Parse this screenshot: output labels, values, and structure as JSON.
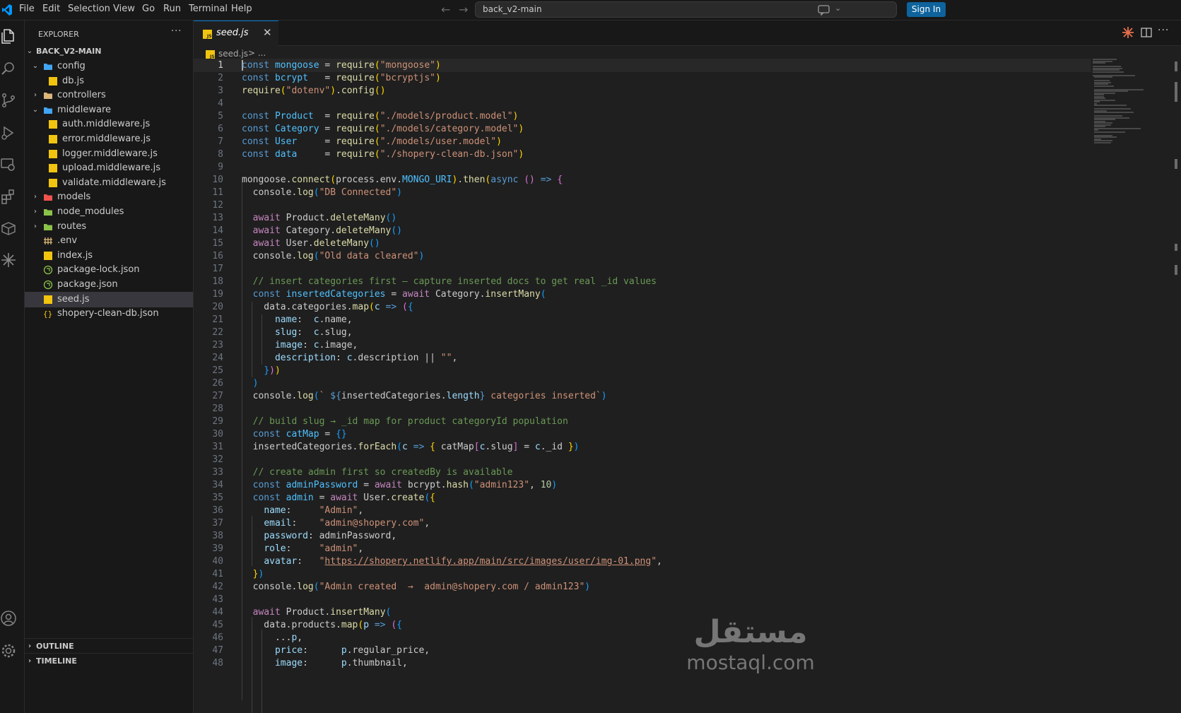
{
  "menu": [
    "File",
    "Edit",
    "Selection",
    "View",
    "Go",
    "Run",
    "Terminal",
    "Help"
  ],
  "command_center": {
    "text": "back_v2-main"
  },
  "sign_in_label": "Sign In",
  "colors": {
    "accent": "#0078d4",
    "sign_in_bg": "#0e639c",
    "js_icon": "#f1c40f",
    "folder": "#dcb67a"
  },
  "activity": [
    "explorer-icon",
    "search-icon",
    "source-control-icon",
    "run-debug-icon",
    "remote-explorer-icon",
    "extensions-icon",
    "containers-icon",
    "sparkle-icon",
    "account-icon",
    "settings-gear-icon"
  ],
  "sidebar": {
    "title": "EXPLORER",
    "more": "···",
    "root": "BACK_V2-MAIN",
    "items": [
      {
        "label": "config",
        "kind": "folder-open",
        "icon": "folder-config-icon"
      },
      {
        "label": "db.js",
        "kind": "js",
        "icon": "js-file-icon"
      },
      {
        "label": "controllers",
        "kind": "folder",
        "icon": "folder-controllers-icon"
      },
      {
        "label": "middleware",
        "kind": "folder-open",
        "icon": "folder-middleware-icon"
      },
      {
        "label": "auth.middleware.js",
        "kind": "js",
        "icon": "js-file-icon"
      },
      {
        "label": "error.middleware.js",
        "kind": "js",
        "icon": "js-file-icon"
      },
      {
        "label": "logger.middleware.js",
        "kind": "js",
        "icon": "js-file-icon"
      },
      {
        "label": "upload.middleware.js",
        "kind": "js",
        "icon": "js-file-icon"
      },
      {
        "label": "validate.middleware.js",
        "kind": "js",
        "icon": "js-file-icon"
      },
      {
        "label": "models",
        "kind": "folder",
        "icon": "folder-models-icon"
      },
      {
        "label": "node_modules",
        "kind": "folder",
        "icon": "folder-node-icon"
      },
      {
        "label": "routes",
        "kind": "folder",
        "icon": "folder-routes-icon"
      },
      {
        "label": ".env",
        "kind": "env",
        "icon": "env-file-icon"
      },
      {
        "label": "index.js",
        "kind": "js",
        "icon": "js-file-icon"
      },
      {
        "label": "package-lock.json",
        "kind": "npm",
        "icon": "npm-json-icon"
      },
      {
        "label": "package.json",
        "kind": "npm",
        "icon": "npm-json-icon"
      },
      {
        "label": "seed.js",
        "kind": "js",
        "icon": "js-file-icon"
      },
      {
        "label": "shopery-clean-db.json",
        "kind": "json",
        "icon": "json-file-icon"
      }
    ],
    "sections": [
      "OUTLINE",
      "TIMELINE"
    ]
  },
  "editor": {
    "tab_label": "seed.js",
    "breadcrumb": {
      "file": "seed.js",
      "rest": "> ..."
    },
    "current_line": 1
  },
  "watermark": {
    "arabic": "مستقل",
    "latin": "mostaql.com"
  }
}
